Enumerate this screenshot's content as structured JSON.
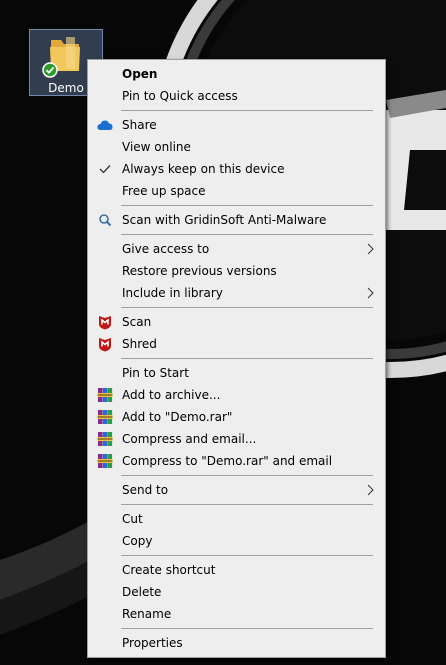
{
  "desktop": {
    "icon_label": "Demo"
  },
  "menu": {
    "open": "Open",
    "pin_quick_access": "Pin to Quick access",
    "share": "Share",
    "view_online": "View online",
    "always_keep": "Always keep on this device",
    "free_up_space": "Free up space",
    "scan_gridinsoft": "Scan with GridinSoft Anti-Malware",
    "give_access": "Give access to",
    "restore_versions": "Restore previous versions",
    "include_library": "Include in library",
    "scan": "Scan",
    "shred": "Shred",
    "pin_start": "Pin to Start",
    "add_archive": "Add to archive...",
    "add_to_rar": "Add to \"Demo.rar\"",
    "compress_email": "Compress and email...",
    "compress_rar_email": "Compress to \"Demo.rar\" and email",
    "send_to": "Send to",
    "cut": "Cut",
    "copy": "Copy",
    "create_shortcut": "Create shortcut",
    "delete": "Delete",
    "rename": "Rename",
    "properties": "Properties"
  },
  "colors": {
    "menu_background": "#eeeeee",
    "separator": "#a0a0a0",
    "onedrive_blue": "#1b6fd0",
    "mcafee_red": "#c01818",
    "sync_green": "#2e9b2e",
    "folder_yellow": "#f2c75c"
  }
}
